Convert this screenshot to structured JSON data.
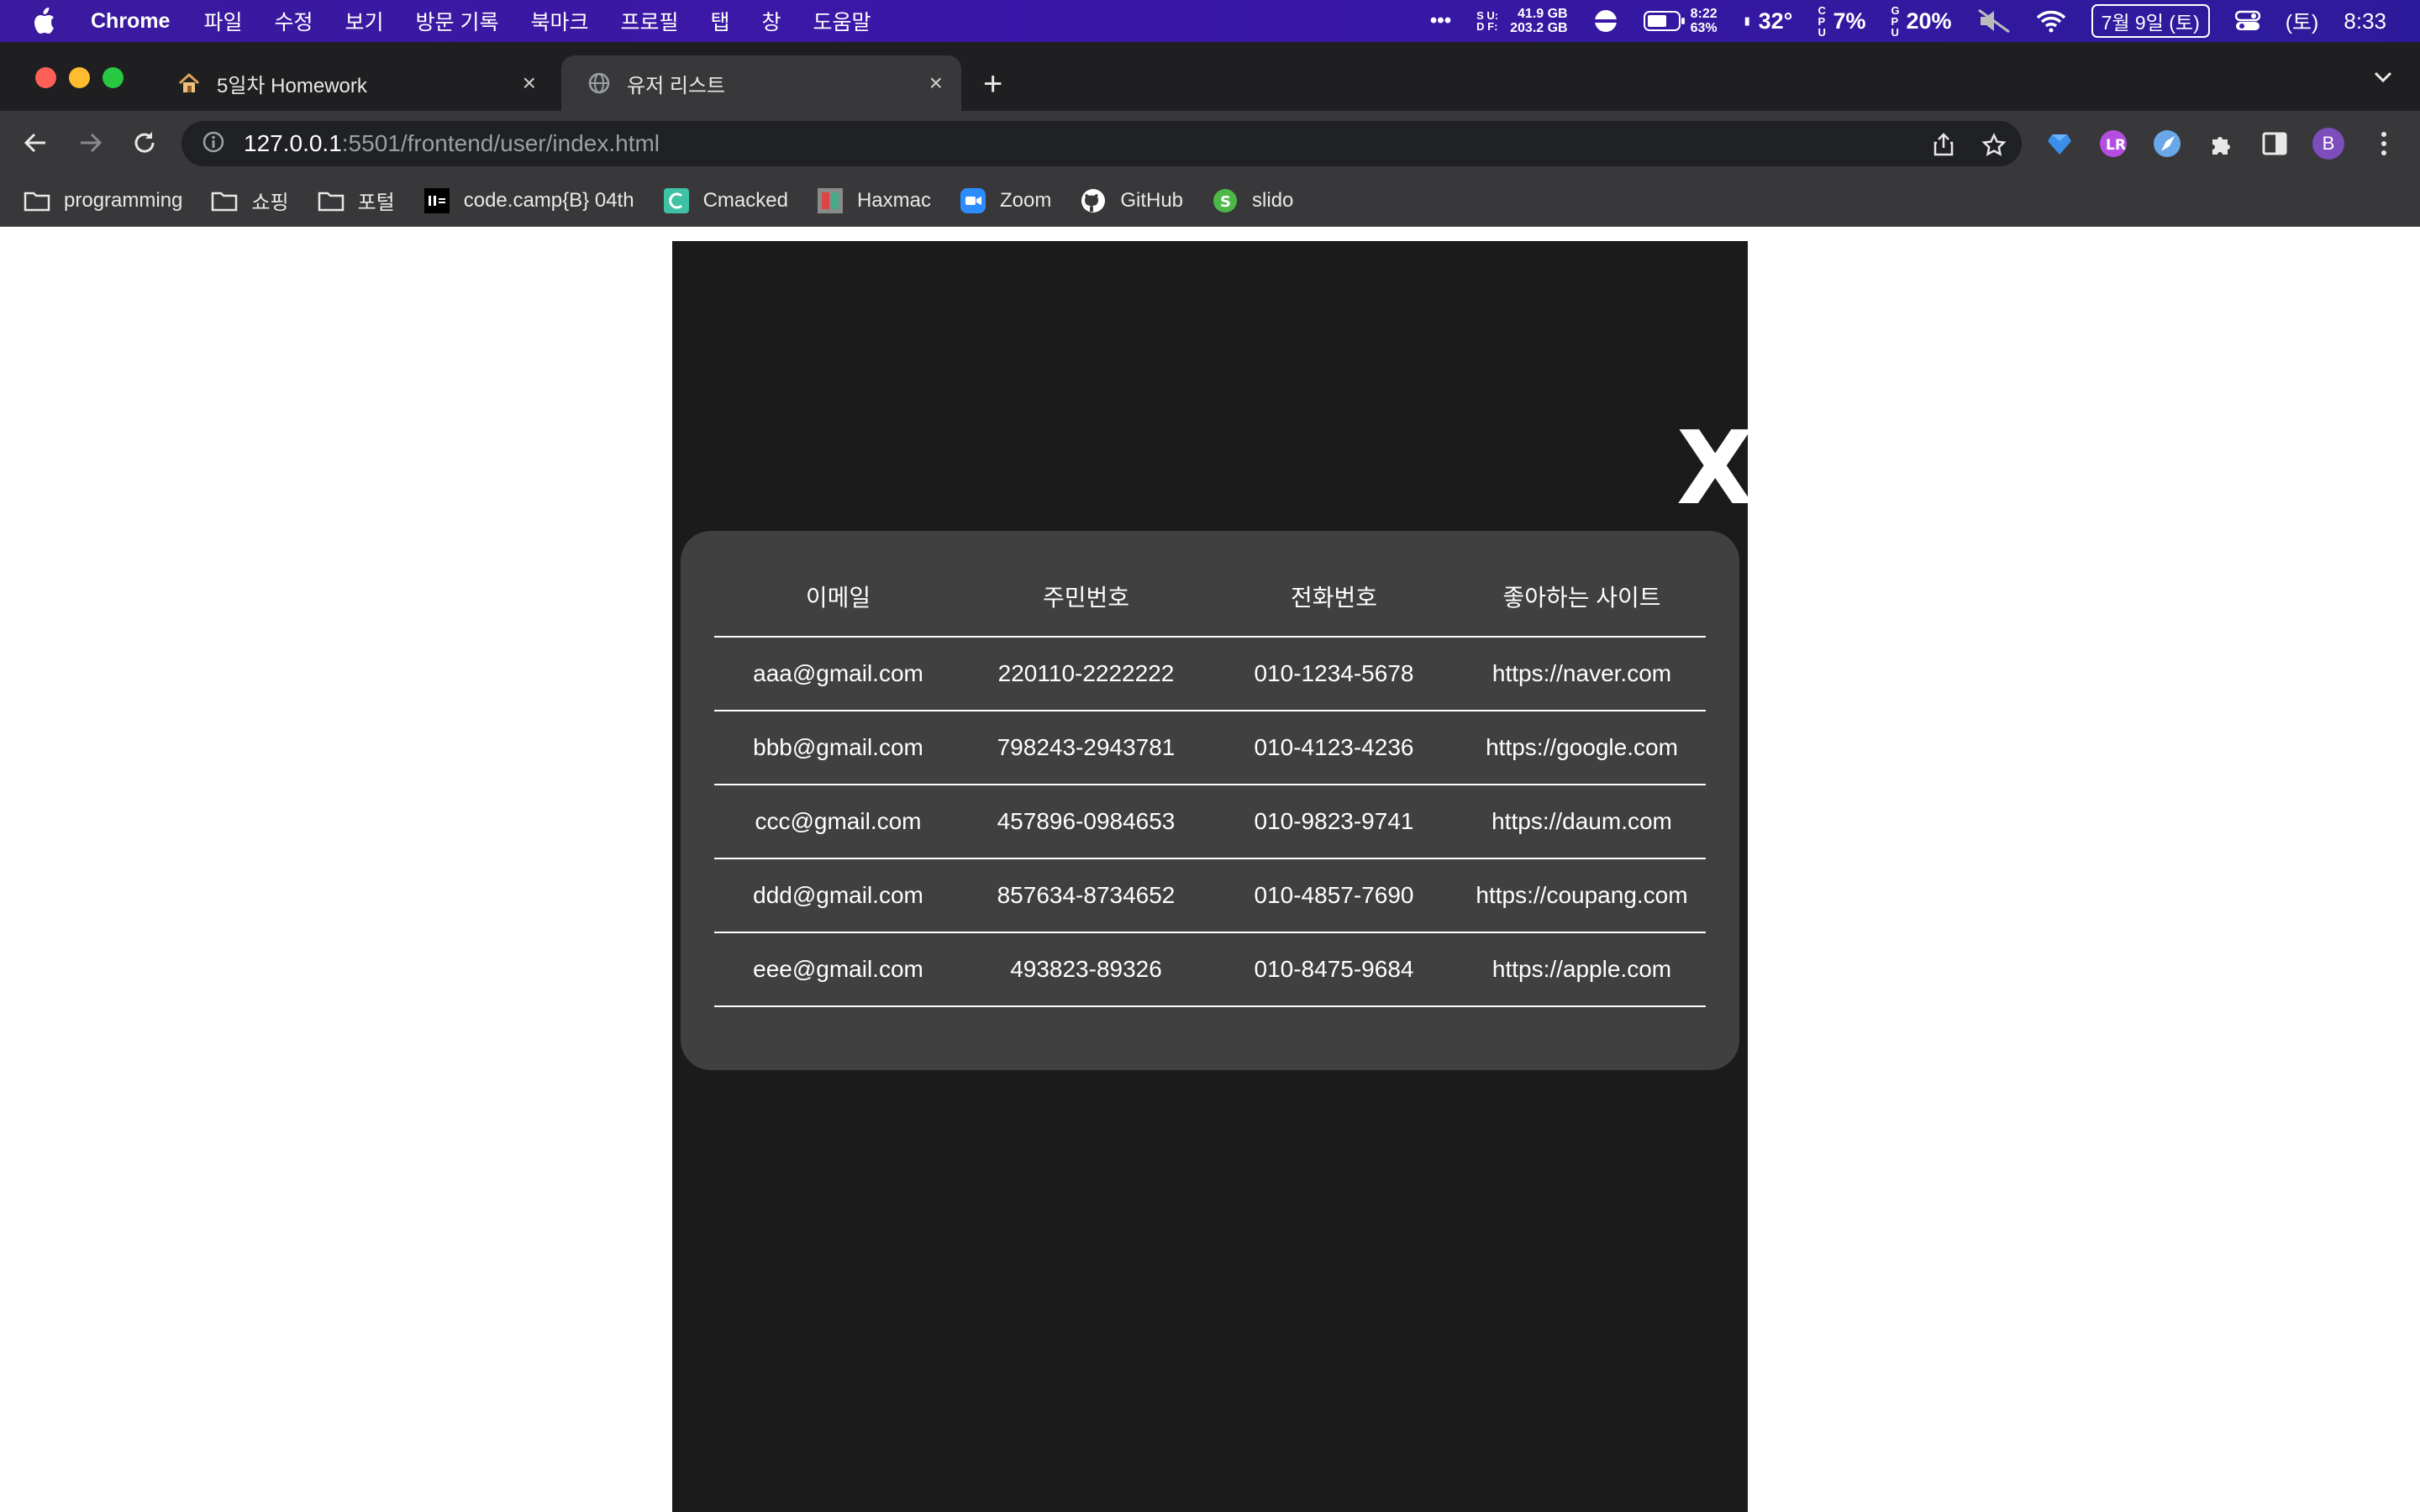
{
  "menubar": {
    "app_name": "Chrome",
    "menus": [
      "파일",
      "수정",
      "보기",
      "방문 기록",
      "북마크",
      "프로필",
      "탭",
      "창",
      "도움말"
    ],
    "more": "•••",
    "disk_labels": [
      "S U:",
      "D F:"
    ],
    "disk_used": "41.9 GB",
    "disk_free": "203.2 GB",
    "battery_time": "8:22",
    "battery_pct": "63%",
    "temp": "32°",
    "cpu_label": "C P U",
    "cpu": "7%",
    "gpu_label": "G P U",
    "gpu": "20%",
    "date": "7월 9일 (토)",
    "day": "(토)",
    "time": "8:33",
    "accent": "#3b17a8"
  },
  "tabs": [
    {
      "title": "5일차 Homework",
      "icon": "house-icon",
      "close": "×"
    },
    {
      "title": "유저 리스트",
      "icon": "globe-icon",
      "close": "×"
    }
  ],
  "new_tab": "+",
  "address": {
    "host": "127.0.0.1",
    "rest": ":5501/frontend/user/index.html"
  },
  "bookmarks": [
    {
      "label": "programming",
      "icon": "folder-icon"
    },
    {
      "label": "쇼핑",
      "icon": "folder-icon"
    },
    {
      "label": "포털",
      "icon": "folder-icon"
    },
    {
      "label": "code.camp{B} 04th",
      "icon": "codecamp-icon"
    },
    {
      "label": "Cmacked",
      "icon": "cmacked-icon"
    },
    {
      "label": "Haxmac",
      "icon": "haxmac-icon"
    },
    {
      "label": "Zoom",
      "icon": "zoom-icon"
    },
    {
      "label": "GitHub",
      "icon": "github-icon"
    },
    {
      "label": "slido",
      "icon": "slido-icon"
    }
  ],
  "profile_initial": "B",
  "page": {
    "close_label": "X",
    "columns": [
      "이메일",
      "주민번호",
      "전화번호",
      "좋아하는 사이트"
    ],
    "rows": [
      [
        "aaa@gmail.com",
        "220110-2222222",
        "010-1234-5678",
        "https://naver.com"
      ],
      [
        "bbb@gmail.com",
        "798243-2943781",
        "010-4123-4236",
        "https://google.com"
      ],
      [
        "ccc@gmail.com",
        "457896-0984653",
        "010-9823-9741",
        "https://daum.com"
      ],
      [
        "ddd@gmail.com",
        "857634-8734652",
        "010-4857-7690",
        "https://coupang.com"
      ],
      [
        "eee@gmail.com",
        "493823-89326",
        "010-8475-9684",
        "https://apple.com"
      ]
    ]
  }
}
